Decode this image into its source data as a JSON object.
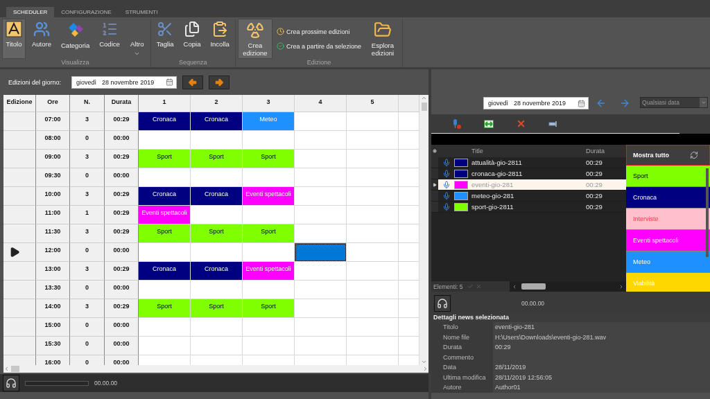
{
  "tabs": [
    {
      "label": "SCHEDULER",
      "selected": true
    },
    {
      "label": "CONFIGURAZIONE",
      "selected": false
    },
    {
      "label": "STRUMENTI",
      "selected": false
    }
  ],
  "ribbon": {
    "groups": [
      {
        "label": "Visualizza",
        "buttons": [
          {
            "kind": "large",
            "label": "Titolo",
            "selected": true
          },
          {
            "kind": "large",
            "label": "Autore",
            "selected": false
          },
          {
            "kind": "large",
            "label": "Categoria",
            "selected": false
          },
          {
            "kind": "large",
            "label": "Codice",
            "selected": false
          },
          {
            "kind": "dropdown",
            "label": "Altro",
            "selected": false
          }
        ]
      },
      {
        "label": "Sequenza",
        "buttons": [
          {
            "kind": "large",
            "label": "Taglia",
            "selected": false
          },
          {
            "kind": "large",
            "label": "Copia",
            "selected": false
          },
          {
            "kind": "large",
            "label": "Incolla",
            "selected": false
          }
        ]
      },
      {
        "label": "Edizione",
        "buttons": [
          {
            "kind": "large",
            "label": "Crea edizione",
            "selected": true
          },
          {
            "kind": "small",
            "label": "Crea prossime edizioni",
            "selected": false
          },
          {
            "kind": "small",
            "label": "Crea a partire da selezione",
            "selected": false
          },
          {
            "kind": "large",
            "label": "Esplora edizioni",
            "selected": false
          }
        ]
      }
    ]
  },
  "day_bar": {
    "label": "Edizioni del giorno:",
    "weekday": "giovedì",
    "date": "28 novembre 2019"
  },
  "schedule": {
    "columns": [
      "Edizione",
      "Ore",
      "N.",
      "Durata",
      "1",
      "2",
      "3",
      "4",
      "5"
    ],
    "rows": [
      {
        "selected": false,
        "time": "07:00",
        "count": "3",
        "duration": "00:29",
        "cells": [
          {
            "label": "Cronaca",
            "color": "#000080",
            "selected": false
          },
          {
            "label": "Cronaca",
            "color": "#000080",
            "selected": false
          },
          {
            "label": "Meteo",
            "color": "#1e90ff",
            "selected": false
          },
          {
            "selected": false
          },
          {
            "selected": false
          }
        ]
      },
      {
        "selected": false,
        "time": "08:00",
        "count": "0",
        "duration": "00:00",
        "cells": [
          {
            "selected": false
          },
          {
            "selected": false
          },
          {
            "selected": false
          },
          {
            "selected": false
          },
          {
            "selected": false
          }
        ]
      },
      {
        "selected": false,
        "time": "09:00",
        "count": "3",
        "duration": "00:29",
        "cells": [
          {
            "label": "Sport",
            "color": "#7fff00",
            "selected": false
          },
          {
            "label": "Sport",
            "color": "#7fff00",
            "selected": false
          },
          {
            "label": "Sport",
            "color": "#7fff00",
            "selected": false
          },
          {
            "selected": false
          },
          {
            "selected": false
          }
        ]
      },
      {
        "selected": false,
        "time": "09:30",
        "count": "0",
        "duration": "00:00",
        "cells": [
          {
            "selected": false
          },
          {
            "selected": false
          },
          {
            "selected": false
          },
          {
            "selected": false
          },
          {
            "selected": false
          }
        ]
      },
      {
        "selected": false,
        "time": "10:00",
        "count": "3",
        "duration": "00:29",
        "cells": [
          {
            "label": "Cronaca",
            "color": "#000080",
            "selected": false
          },
          {
            "label": "Cronaca",
            "color": "#000080",
            "selected": false
          },
          {
            "label": "Eventi spettacoli",
            "color": "#ff00ff",
            "selected": false
          },
          {
            "selected": false
          },
          {
            "selected": false
          }
        ]
      },
      {
        "selected": false,
        "time": "11:00",
        "count": "1",
        "duration": "00:29",
        "cells": [
          {
            "label": "Eventi spettacoli",
            "color": "#ff00ff",
            "selected": false
          },
          {
            "selected": false
          },
          {
            "selected": false
          },
          {
            "selected": false
          },
          {
            "selected": false
          }
        ]
      },
      {
        "selected": false,
        "time": "11:30",
        "count": "3",
        "duration": "00:29",
        "cells": [
          {
            "label": "Sport",
            "color": "#7fff00",
            "selected": false
          },
          {
            "label": "Sport",
            "color": "#7fff00",
            "selected": false
          },
          {
            "label": "Sport",
            "color": "#7fff00",
            "selected": false
          },
          {
            "selected": false
          },
          {
            "selected": false
          }
        ]
      },
      {
        "selected": true,
        "time": "12:00",
        "count": "0",
        "duration": "00:00",
        "cells": [
          {
            "selected": false
          },
          {
            "selected": false
          },
          {
            "selected": false
          },
          {
            "selected": true
          },
          {
            "selected": false
          }
        ]
      },
      {
        "selected": false,
        "time": "13:00",
        "count": "3",
        "duration": "00:29",
        "cells": [
          {
            "label": "Cronaca",
            "color": "#000080",
            "selected": false
          },
          {
            "label": "Cronaca",
            "color": "#000080",
            "selected": false
          },
          {
            "label": "Eventi spettacoli",
            "color": "#ff00ff",
            "selected": false
          },
          {
            "selected": false
          },
          {
            "selected": false
          }
        ]
      },
      {
        "selected": false,
        "time": "13:30",
        "count": "0",
        "duration": "00:00",
        "cells": [
          {
            "selected": false
          },
          {
            "selected": false
          },
          {
            "selected": false
          },
          {
            "selected": false
          },
          {
            "selected": false
          }
        ]
      },
      {
        "selected": false,
        "time": "14:00",
        "count": "3",
        "duration": "00:29",
        "cells": [
          {
            "label": "Sport",
            "color": "#7fff00",
            "selected": false
          },
          {
            "label": "Sport",
            "color": "#7fff00",
            "selected": false
          },
          {
            "label": "Sport",
            "color": "#7fff00",
            "selected": false
          },
          {
            "selected": false
          },
          {
            "selected": false
          }
        ]
      },
      {
        "selected": false,
        "time": "15:00",
        "count": "0",
        "duration": "00:00",
        "cells": [
          {
            "selected": false
          },
          {
            "selected": false
          },
          {
            "selected": false
          },
          {
            "selected": false
          },
          {
            "selected": false
          }
        ]
      },
      {
        "selected": false,
        "time": "15:30",
        "count": "0",
        "duration": "00:00",
        "cells": [
          {
            "selected": false
          },
          {
            "selected": false
          },
          {
            "selected": false
          },
          {
            "selected": false
          },
          {
            "selected": false
          }
        ]
      },
      {
        "selected": false,
        "time": "16:00",
        "count": "0",
        "duration": "00:00",
        "cells": [
          {
            "selected": false
          },
          {
            "selected": false
          },
          {
            "selected": false
          },
          {
            "selected": false
          },
          {
            "selected": false
          }
        ]
      }
    ]
  },
  "left_player": {
    "time": "00.00.00"
  },
  "right_panel": {
    "weekday": "giovedì",
    "date": "28 novembre 2019",
    "date_filter": "Qualsiasi data",
    "list": {
      "columns": [
        "Title",
        "Durata"
      ],
      "items": [
        {
          "title": "attualità-gio-2811",
          "duration": "00:29",
          "color": "#000080",
          "selected": false
        },
        {
          "title": "cronaca-gio-2811",
          "duration": "00:29",
          "color": "#000080",
          "selected": false
        },
        {
          "title": "eventi-gio-281",
          "duration": "00:29",
          "color": "#ff00ff",
          "selected": true
        },
        {
          "title": "meteo-gio-281",
          "duration": "00:29",
          "color": "#1e90ff",
          "selected": false
        },
        {
          "title": "sport-gio-2811",
          "duration": "00:29",
          "color": "#7fff00",
          "selected": false
        }
      ],
      "footer": "Elementi: 5"
    },
    "categories": {
      "header": "Mostra tutto",
      "items": [
        {
          "label": "Sport",
          "color": "#7fff00"
        },
        {
          "label": "Cronaca",
          "color": "#000080"
        },
        {
          "label": "Interviste",
          "color": "#ffc0cb"
        },
        {
          "label": "Eventi spettacoli",
          "color": "#ff00ff"
        },
        {
          "label": "Meteo",
          "color": "#1e90ff"
        },
        {
          "label": "Viabilità",
          "color": "#ffd700"
        }
      ]
    },
    "player": {
      "time": "00.00.00"
    },
    "details": {
      "title": "Dettagli news selezionata",
      "fields": [
        {
          "label": "Titolo",
          "value": "eventi-gio-281"
        },
        {
          "label": "Nome file",
          "value": "H:\\Users\\Downloads\\eventi-gio-281.wav"
        },
        {
          "label": "Durata",
          "value": "00:29"
        },
        {
          "label": "Commento"
        },
        {
          "label": "Data",
          "value": "28/11/2019"
        },
        {
          "label": "Ultima modifica",
          "value": "28/11/2019 12:56:05"
        },
        {
          "label": "Autore",
          "value": "Author01"
        }
      ]
    }
  }
}
